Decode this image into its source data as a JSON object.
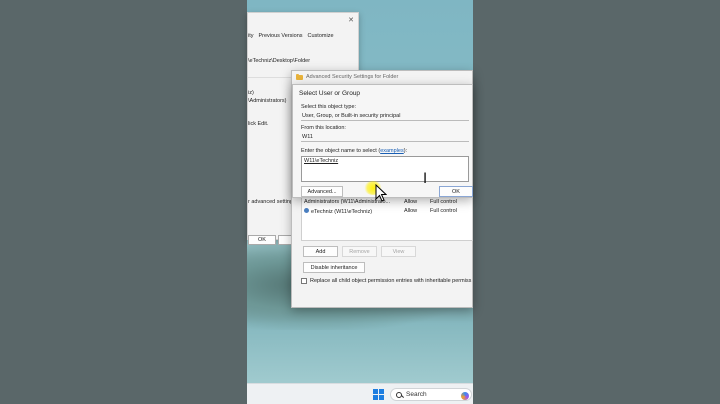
{
  "properties_window": {
    "tab_previous_versions": "Previous Versions",
    "tab_customize": "Customize",
    "tab_security_partial": "ity",
    "object_path": "\\eTechniz\\Desktop\\Folder",
    "group_line_1": "iz)",
    "group_line_2": "\\Administrators)",
    "edit_hint": "lick Edit.",
    "advanced_hint": "r advanced settings",
    "ok_label": "OK"
  },
  "advanced_security": {
    "title": "Advanced Security Settings for Folder",
    "entries": [
      {
        "name": "Administrators (W11\\Administrato...",
        "access": "Allow",
        "permission": "Full control"
      },
      {
        "name": "eTechniz (W11\\eTechniz)",
        "access": "Allow",
        "permission": "Full control"
      }
    ],
    "add_label": "Add",
    "remove_label": "Remove",
    "view_label": "View",
    "disable_inheritance_label": "Disable inheritance",
    "replace_checkbox_label": "Replace all child object permission entries with inheritable permiss"
  },
  "select_user_dialog": {
    "title": "Select User or Group",
    "object_type_label": "Select this object type:",
    "object_type_value": "User, Group, or Built-in security principal",
    "location_label": "From this location:",
    "location_value": "W11",
    "enter_name_label": "Enter the object name to select (",
    "examples_link": "examples",
    "enter_name_suffix": "):",
    "name_value": "W11\\eTechniz",
    "advanced_label": "Advanced...",
    "ok_label": "OK"
  },
  "taskbar": {
    "search_placeholder": "Search"
  },
  "colors": {
    "accent": "#1d7ee0",
    "link": "#1a5fb4",
    "highlight": "#fff000"
  }
}
